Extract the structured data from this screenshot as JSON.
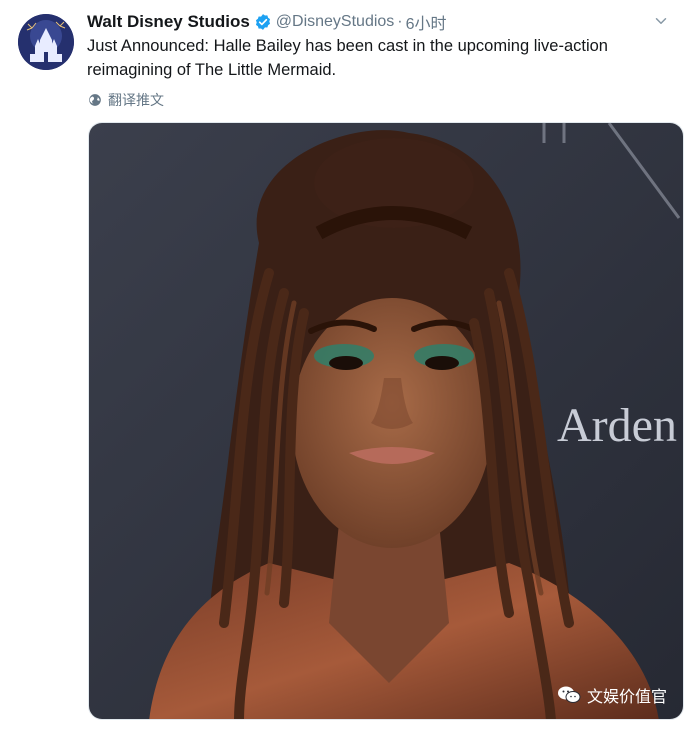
{
  "tweet": {
    "author": {
      "display_name": "Walt Disney Studios",
      "handle": "@DisneyStudios",
      "verified": true,
      "avatar_icon": "disney-castle-icon"
    },
    "separator": "·",
    "timestamp": "6小时",
    "text": "Just Announced: Halle Bailey has been cast in the upcoming live-action reimagining of The Little Mermaid.",
    "translate_label": "翻译推文",
    "menu_icon": "chevron-down-icon"
  },
  "media": {
    "backdrop_text": "Arden",
    "watermark_text": "文娱价值官",
    "watermark_icon": "wechat-icon"
  },
  "colors": {
    "text_primary": "#14171a",
    "text_secondary": "#657786",
    "verified_blue": "#1da1f2"
  }
}
